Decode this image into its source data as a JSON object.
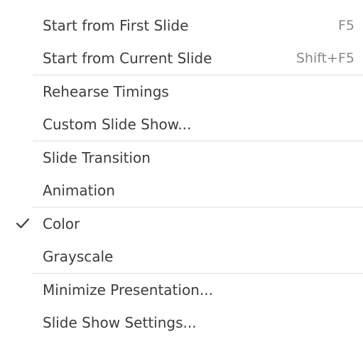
{
  "menu": {
    "groups": [
      {
        "items": [
          {
            "label": "Start from First Slide",
            "shortcut": "F5"
          },
          {
            "label": "Start from Current Slide",
            "shortcut": "Shift+F5"
          }
        ]
      },
      {
        "items": [
          {
            "label": "Rehearse Timings"
          },
          {
            "label": "Custom Slide Show..."
          }
        ]
      },
      {
        "items": [
          {
            "label": "Slide Transition"
          },
          {
            "label": "Animation"
          }
        ]
      },
      {
        "items": [
          {
            "label": "Color",
            "checked": true,
            "icon": "check-icon"
          },
          {
            "label": "Grayscale"
          }
        ]
      },
      {
        "items": [
          {
            "label": "Minimize Presentation..."
          },
          {
            "label": "Slide Show Settings..."
          }
        ]
      }
    ]
  },
  "colors": {
    "text": "#3c3c3c",
    "shortcut": "#8a8a8a",
    "separator": "#dcdcdc",
    "background": "#ffffff"
  }
}
